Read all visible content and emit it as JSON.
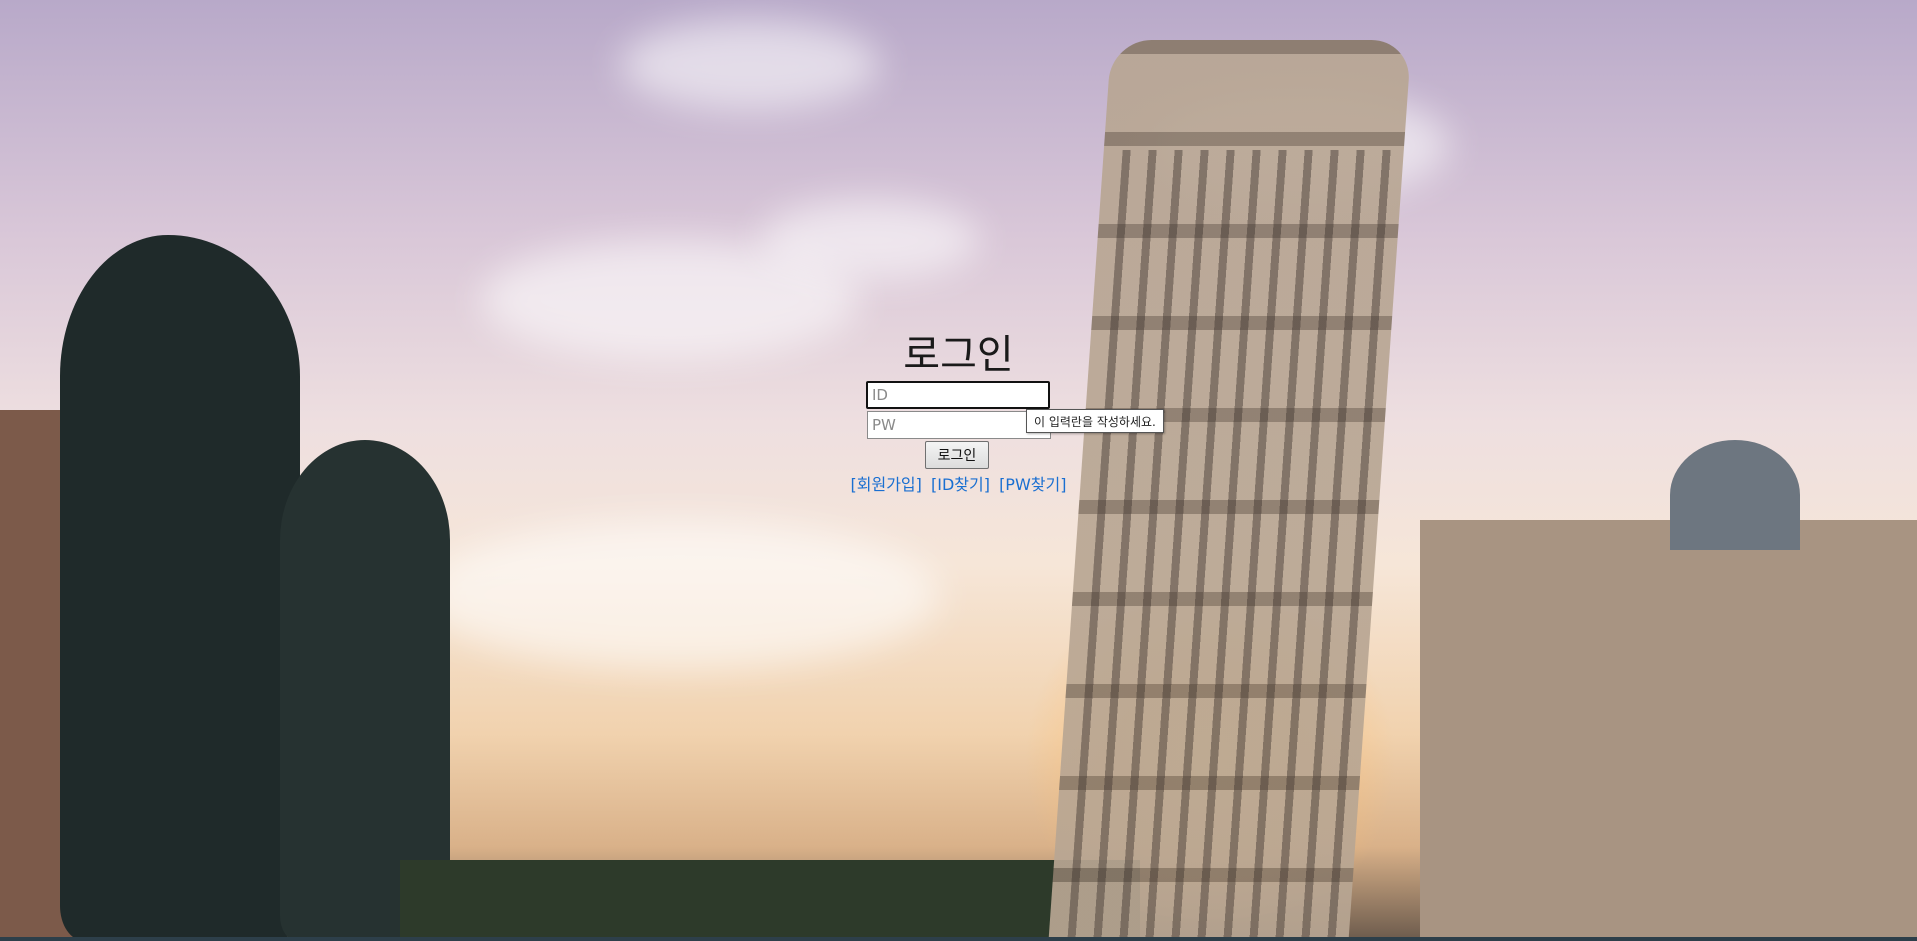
{
  "login": {
    "title": "로그인",
    "id_placeholder": "ID",
    "pw_placeholder": "PW",
    "validation_tooltip": "이 입력란을 작성하세요.",
    "submit_label": "로그인",
    "links": [
      {
        "label": "[회원가입]"
      },
      {
        "label": "[ID찾기]"
      },
      {
        "label": "[PW찾기]"
      }
    ]
  },
  "colors": {
    "link": "#1a6fd1",
    "title": "#1a1a1a"
  },
  "background": {
    "subject": "leaning-tower-of-pisa-sunset-photo"
  }
}
